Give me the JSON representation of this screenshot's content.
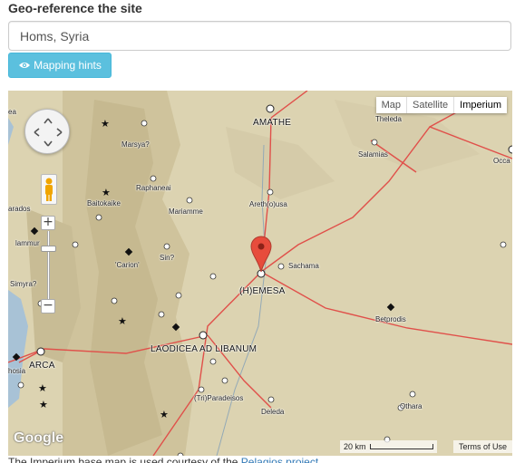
{
  "heading": "Geo-reference the site",
  "site_input": {
    "value": "Homs, Syria",
    "placeholder": ""
  },
  "hints_button": {
    "label": "Mapping hints",
    "icon": "eye-icon"
  },
  "map": {
    "map_types": [
      "Map",
      "Satellite",
      "Imperium"
    ],
    "active_map_type": "Imperium",
    "zoom_in": "+",
    "zoom_out": "−",
    "places": {
      "amathe": "AMATHE",
      "theleda": "Theleda",
      "marsya": "Marsya?",
      "salamias": "Salamias",
      "occa": "Occa",
      "raphaneai": "Raphaneai",
      "baitokaike": "Baitokaike",
      "mariamme": "Mariamme",
      "arethousa": "Areth(o)usa",
      "arados": "arados",
      "lammura": "lammur",
      "carion": "'Carion'",
      "sin": "Sin?",
      "sachama": "Sachama",
      "simyra": "Simyra?",
      "hemesa": "(H)EMESA",
      "betprodis": "Betprodis",
      "laodicea": "LAODICEA AD LIBANUM",
      "hosia": "hosia",
      "arca": "ARCA",
      "triparadeisos": "(Tri)Paradeisos",
      "deleda": "Deleda",
      "othara": "Othara",
      "ea": "ea"
    },
    "scale_label": "20 km",
    "terms": "Terms of Use",
    "google": "Google"
  },
  "credit": {
    "text": "The Imperium base map is used courtesy of the ",
    "link": "Pelagios project"
  },
  "colors": {
    "road": "#e0504a",
    "terrain": "#d9cfae",
    "sea": "#a8c2d6",
    "button": "#5bc0de",
    "marker": "#e74c3c"
  }
}
